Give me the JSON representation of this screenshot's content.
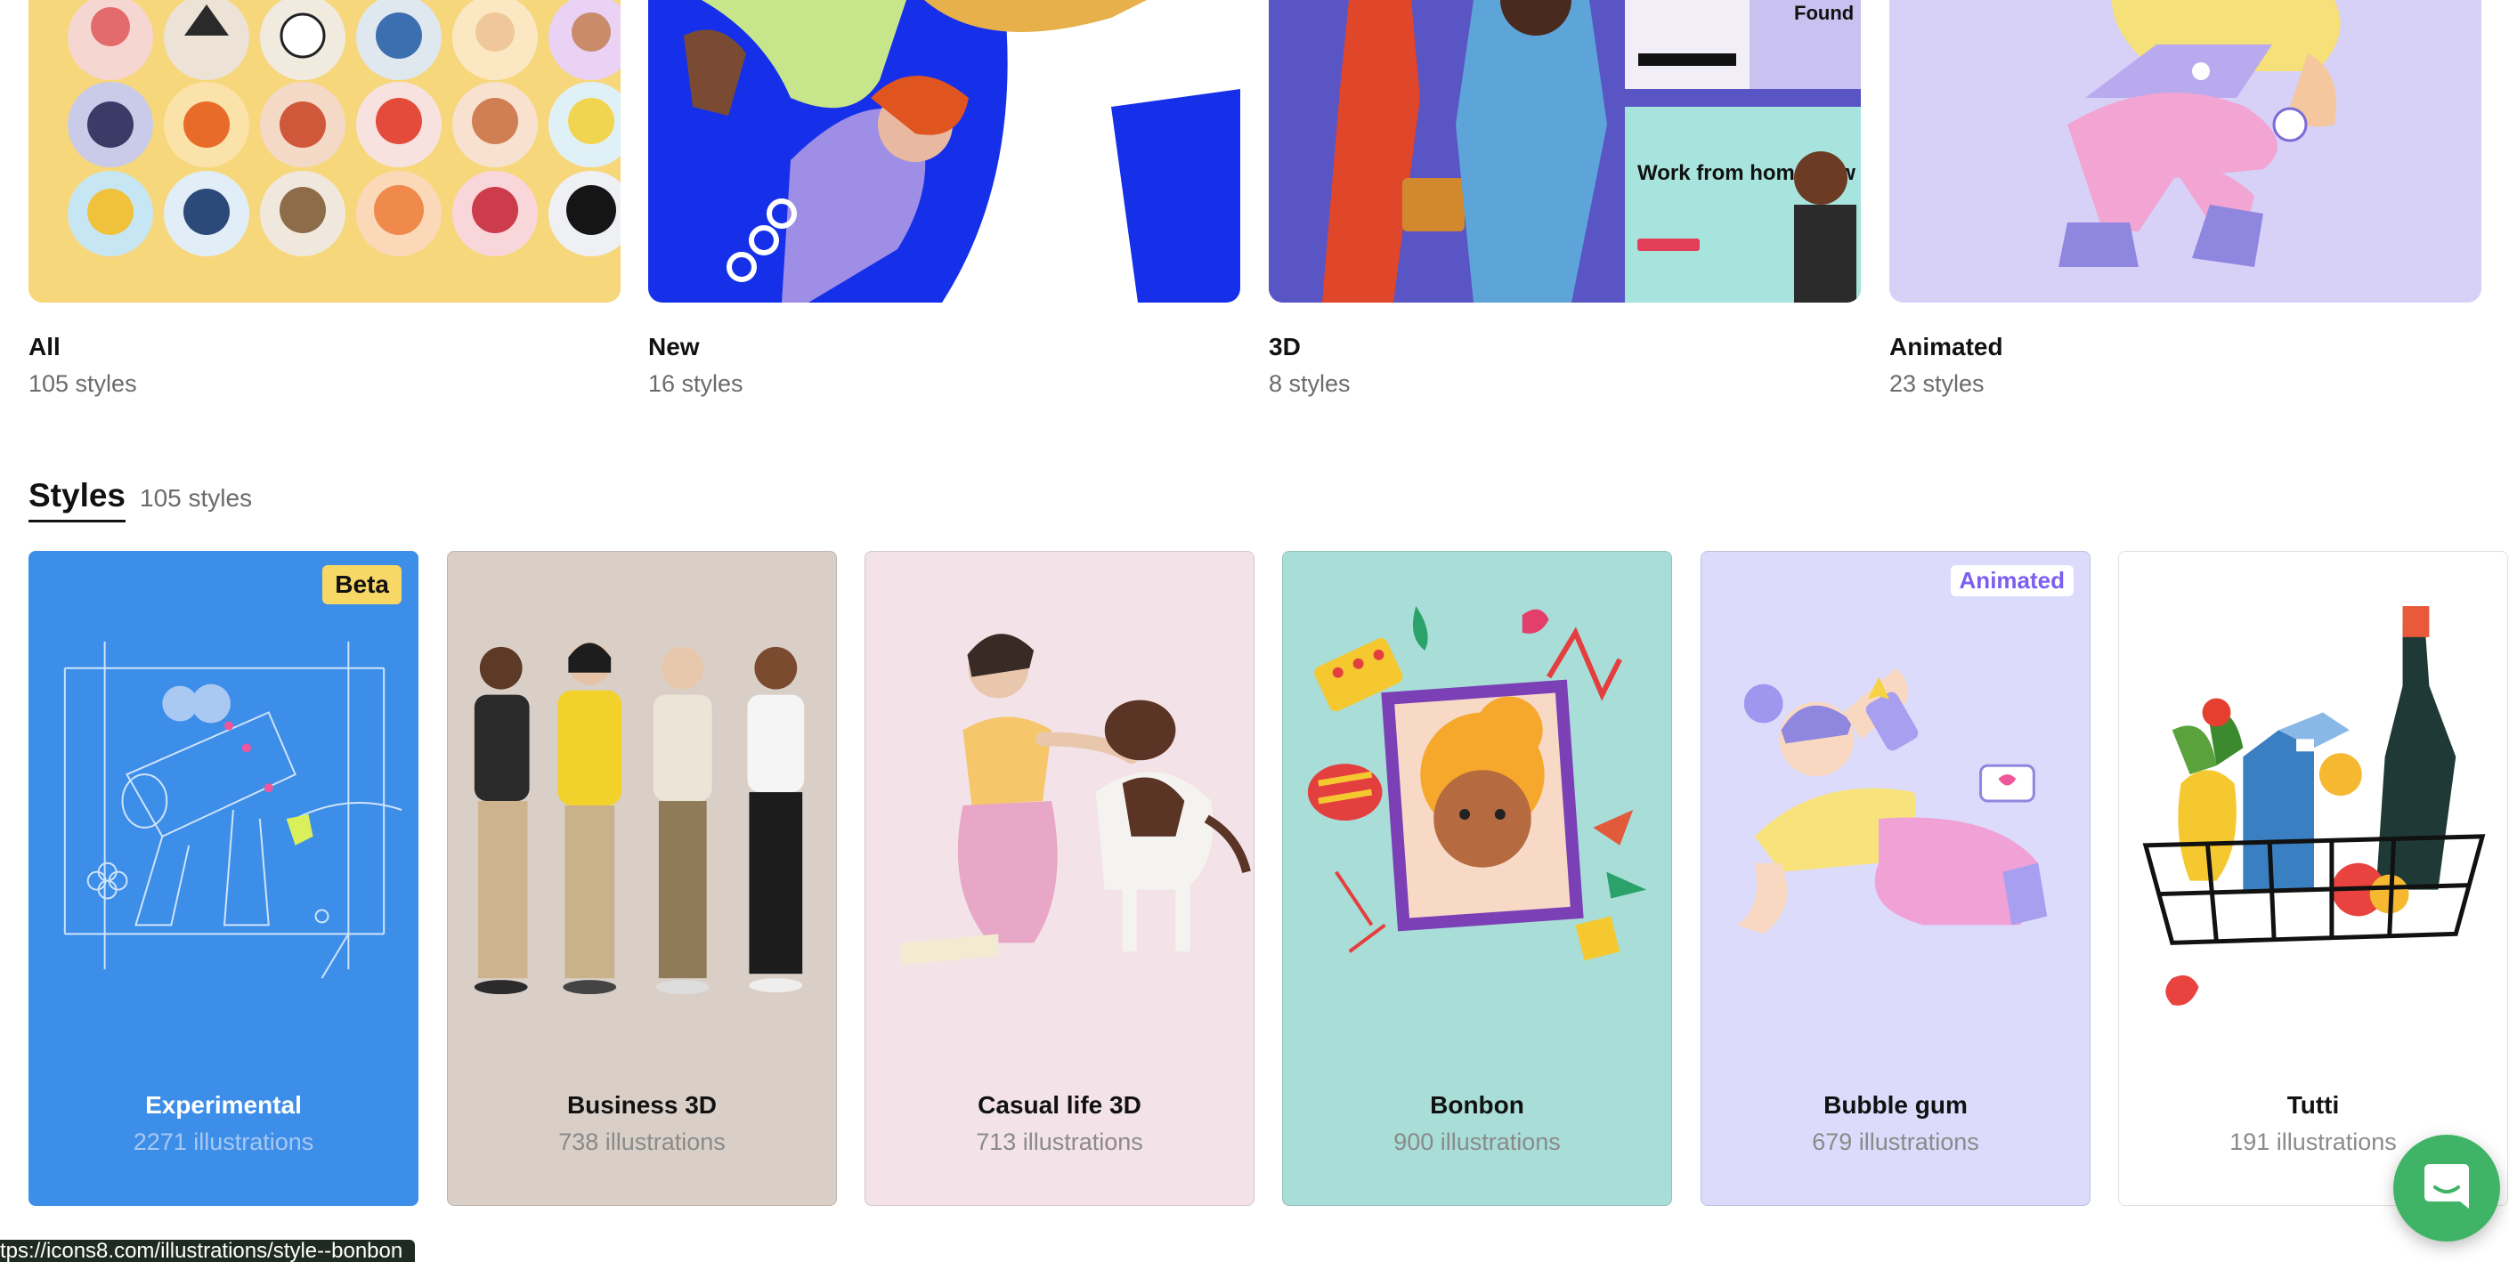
{
  "categories": [
    {
      "name": "All",
      "count": "105 styles",
      "bg": "#f7d77c"
    },
    {
      "name": "New",
      "count": "16 styles",
      "bg": "#1530e8"
    },
    {
      "name": "3D",
      "count": "8 styles",
      "bg": "#5a55c4"
    },
    {
      "name": "Animated",
      "count": "23 styles",
      "bg": "#d7d1f7"
    }
  ],
  "styles_section": {
    "title": "Styles",
    "count": "105 styles"
  },
  "style_cards": [
    {
      "title": "Experimental",
      "subtitle": "2271 illustrations",
      "badge": "Beta",
      "bg": "#3d8ee8"
    },
    {
      "title": "Business 3D",
      "subtitle": "738 illustrations",
      "bg": "#d9cfc7"
    },
    {
      "title": "Casual life 3D",
      "subtitle": "713 illustrations",
      "bg": "#f3e3e8"
    },
    {
      "title": "Bonbon",
      "subtitle": "900 illustrations",
      "bg": "#a9ddd8"
    },
    {
      "title": "Bubble gum",
      "subtitle": "679 illustrations",
      "badge": "Animated",
      "bg": "#dcdbfb"
    },
    {
      "title": "Tutti",
      "subtitle": "191 illustrations",
      "bg": "#ffffff"
    }
  ],
  "thumb_texts": {
    "found": "Found",
    "work_from_home": "Work from home now"
  },
  "status_url": "tps://icons8.com/illustrations/style--bonbon",
  "icons": {
    "chat": "chat-icon"
  }
}
